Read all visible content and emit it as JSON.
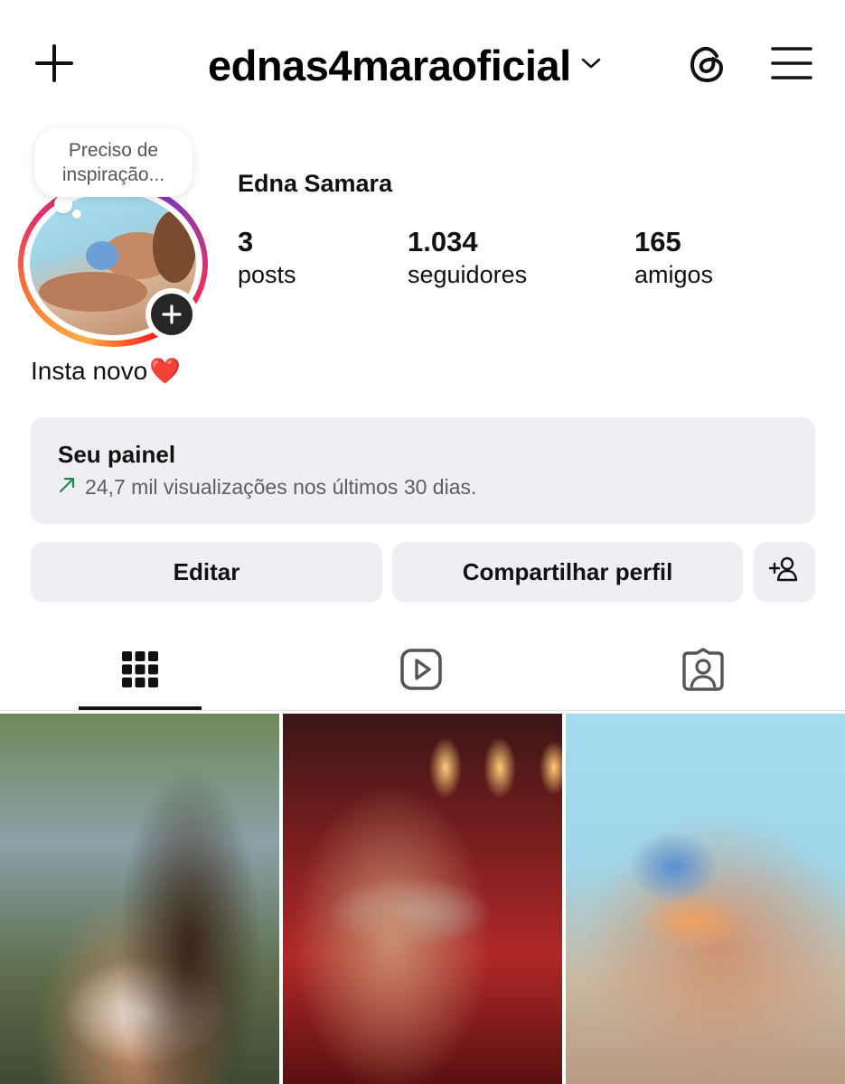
{
  "header": {
    "username": "ednas4maraoficial",
    "icons": [
      "plus-icon",
      "chevron-down-icon",
      "threads-icon",
      "menu-icon"
    ]
  },
  "profile": {
    "note": "Preciso de inspiração...",
    "full_name": "Edna Samara",
    "bio": "Insta novo",
    "bio_emoji": "❤️",
    "stats": {
      "posts": {
        "value": "3",
        "label": "posts"
      },
      "followers": {
        "value": "1.034",
        "label": "seguidores"
      },
      "friends": {
        "value": "165",
        "label": "amigos"
      }
    }
  },
  "dashboard": {
    "title": "Seu painel",
    "subtitle": "24,7 mil visualizações nos últimos 30 dias.",
    "trend_color": "#1f8a4c"
  },
  "actions": {
    "edit": "Editar",
    "share": "Compartilhar perfil"
  },
  "tabs": [
    "grid-icon",
    "reels-icon",
    "tagged-icon"
  ],
  "colors": {
    "accent_ring": [
      "#fcaf45",
      "#f77737",
      "#e1306c",
      "#833ab4"
    ],
    "button_bg": "#efeff3"
  }
}
